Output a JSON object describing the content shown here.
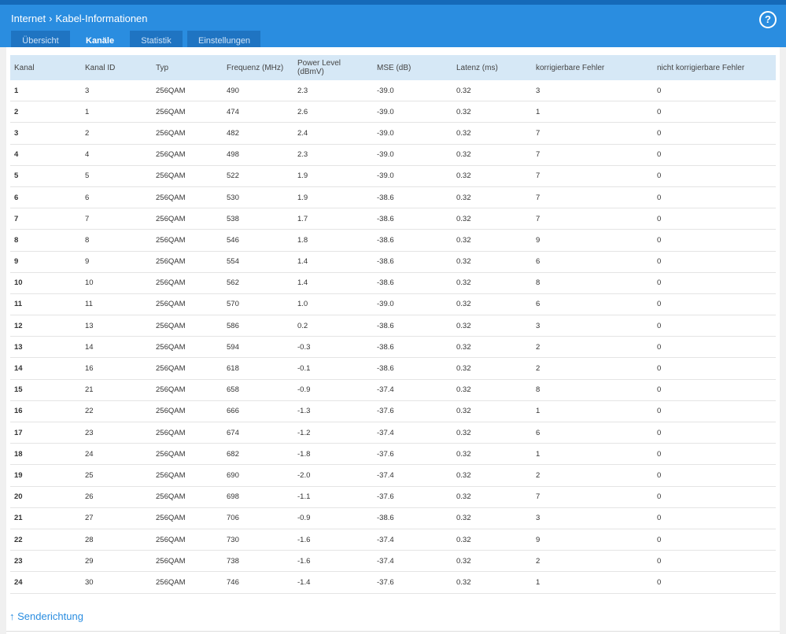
{
  "header": {
    "breadcrumb_parent": "Internet",
    "breadcrumb_separator": "›",
    "breadcrumb_current": "Kabel-Informationen",
    "help_icon": "?"
  },
  "tabs": [
    {
      "label": "Übersicht",
      "active": false
    },
    {
      "label": "Kanäle",
      "active": true
    },
    {
      "label": "Statistik",
      "active": false
    },
    {
      "label": "Einstellungen",
      "active": false
    }
  ],
  "table": {
    "columns": [
      "Kanal",
      "Kanal ID",
      "Typ",
      "Frequenz (MHz)",
      "Power Level (dBmV)",
      "MSE (dB)",
      "Latenz (ms)",
      "korrigierbare Fehler",
      "nicht korrigierbare Fehler"
    ],
    "rows": [
      [
        "1",
        "3",
        "256QAM",
        "490",
        "2.3",
        "-39.0",
        "0.32",
        "3",
        "0"
      ],
      [
        "2",
        "1",
        "256QAM",
        "474",
        "2.6",
        "-39.0",
        "0.32",
        "1",
        "0"
      ],
      [
        "3",
        "2",
        "256QAM",
        "482",
        "2.4",
        "-39.0",
        "0.32",
        "7",
        "0"
      ],
      [
        "4",
        "4",
        "256QAM",
        "498",
        "2.3",
        "-39.0",
        "0.32",
        "7",
        "0"
      ],
      [
        "5",
        "5",
        "256QAM",
        "522",
        "1.9",
        "-39.0",
        "0.32",
        "7",
        "0"
      ],
      [
        "6",
        "6",
        "256QAM",
        "530",
        "1.9",
        "-38.6",
        "0.32",
        "7",
        "0"
      ],
      [
        "7",
        "7",
        "256QAM",
        "538",
        "1.7",
        "-38.6",
        "0.32",
        "7",
        "0"
      ],
      [
        "8",
        "8",
        "256QAM",
        "546",
        "1.8",
        "-38.6",
        "0.32",
        "9",
        "0"
      ],
      [
        "9",
        "9",
        "256QAM",
        "554",
        "1.4",
        "-38.6",
        "0.32",
        "6",
        "0"
      ],
      [
        "10",
        "10",
        "256QAM",
        "562",
        "1.4",
        "-38.6",
        "0.32",
        "8",
        "0"
      ],
      [
        "11",
        "11",
        "256QAM",
        "570",
        "1.0",
        "-39.0",
        "0.32",
        "6",
        "0"
      ],
      [
        "12",
        "13",
        "256QAM",
        "586",
        "0.2",
        "-38.6",
        "0.32",
        "3",
        "0"
      ],
      [
        "13",
        "14",
        "256QAM",
        "594",
        "-0.3",
        "-38.6",
        "0.32",
        "2",
        "0"
      ],
      [
        "14",
        "16",
        "256QAM",
        "618",
        "-0.1",
        "-38.6",
        "0.32",
        "2",
        "0"
      ],
      [
        "15",
        "21",
        "256QAM",
        "658",
        "-0.9",
        "-37.4",
        "0.32",
        "8",
        "0"
      ],
      [
        "16",
        "22",
        "256QAM",
        "666",
        "-1.3",
        "-37.6",
        "0.32",
        "1",
        "0"
      ],
      [
        "17",
        "23",
        "256QAM",
        "674",
        "-1.2",
        "-37.4",
        "0.32",
        "6",
        "0"
      ],
      [
        "18",
        "24",
        "256QAM",
        "682",
        "-1.8",
        "-37.6",
        "0.32",
        "1",
        "0"
      ],
      [
        "19",
        "25",
        "256QAM",
        "690",
        "-2.0",
        "-37.4",
        "0.32",
        "2",
        "0"
      ],
      [
        "20",
        "26",
        "256QAM",
        "698",
        "-1.1",
        "-37.6",
        "0.32",
        "7",
        "0"
      ],
      [
        "21",
        "27",
        "256QAM",
        "706",
        "-0.9",
        "-38.6",
        "0.32",
        "3",
        "0"
      ],
      [
        "22",
        "28",
        "256QAM",
        "730",
        "-1.6",
        "-37.4",
        "0.32",
        "9",
        "0"
      ],
      [
        "23",
        "29",
        "256QAM",
        "738",
        "-1.6",
        "-37.4",
        "0.32",
        "2",
        "0"
      ],
      [
        "24",
        "30",
        "256QAM",
        "746",
        "-1.4",
        "-37.6",
        "0.32",
        "1",
        "0"
      ]
    ]
  },
  "footer": {
    "arrow_icon": "↑",
    "section_label": "Senderichtung"
  },
  "colors": {
    "header_blue": "#2a8de0",
    "tab_active_underline": "#ffd400",
    "table_header_bg": "#d6e8f6"
  }
}
